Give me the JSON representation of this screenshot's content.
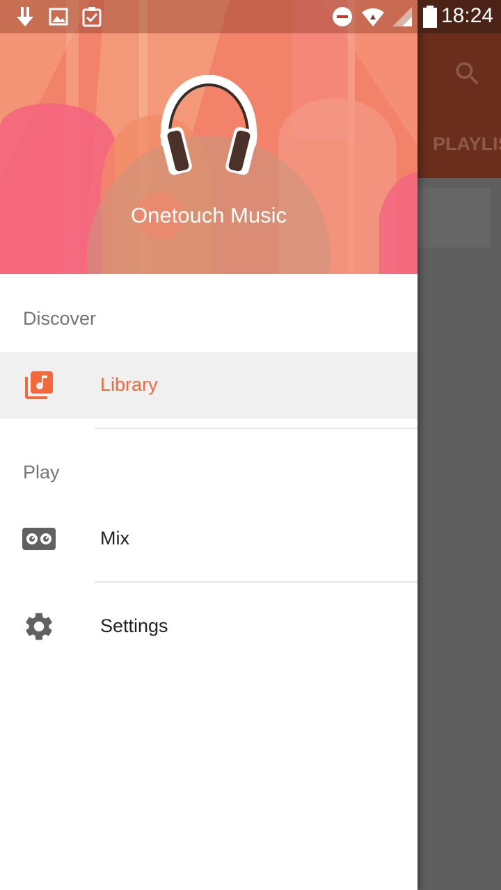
{
  "status_bar": {
    "time": "18:24",
    "left_icons": [
      "download-icon",
      "image-icon",
      "clipboard-check-icon"
    ],
    "right_icons": [
      "do-not-disturb-icon",
      "wifi-icon",
      "signal-icon",
      "battery-icon"
    ]
  },
  "background_app": {
    "tab_label": "PLAYLIS",
    "toolbar_icon": "search-icon"
  },
  "drawer": {
    "header": {
      "app_name": "Onetouch Music",
      "logo_icon": "headphones-icon"
    },
    "sections": [
      {
        "title": "Discover",
        "items": [
          {
            "label": "Library",
            "icon": "library-music-icon",
            "active": true
          }
        ]
      },
      {
        "title": "Play",
        "items": [
          {
            "label": "Mix",
            "icon": "mix-icon",
            "active": false
          }
        ]
      }
    ],
    "footer_items": [
      {
        "label": "Settings",
        "icon": "settings-icon",
        "active": false
      }
    ]
  },
  "colors": {
    "accent": "#f4693c",
    "icon_grey": "#616161",
    "toolbar_dim": "#6b2e1c",
    "scrim": "#5f5f5f"
  }
}
